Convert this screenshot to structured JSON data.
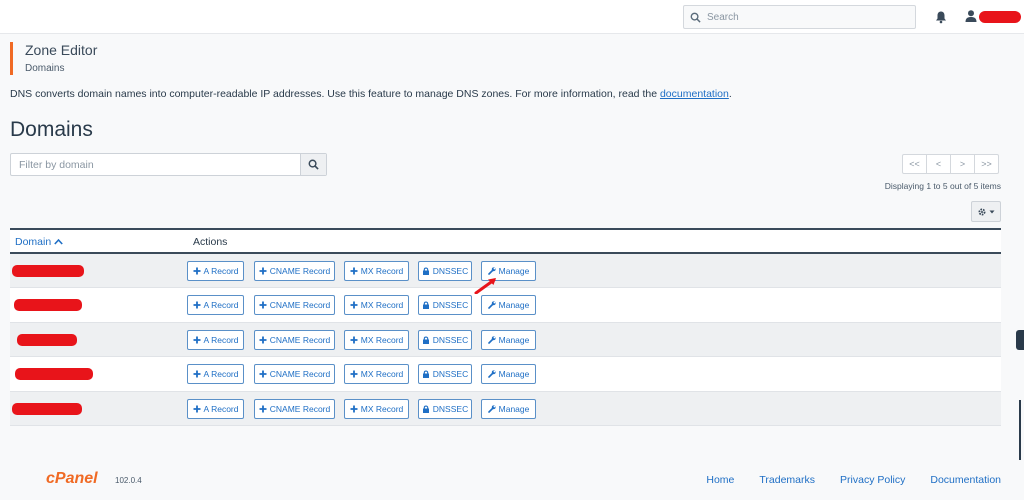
{
  "topbar": {
    "search_placeholder": "Search",
    "icons": [
      "search-icon",
      "bell-icon",
      "user-icon"
    ]
  },
  "breadcrumb": {
    "title": "Zone Editor",
    "subtitle": "Domains"
  },
  "description": {
    "text": "DNS converts domain names into computer-readable IP addresses. Use this feature to manage DNS zones. For more information, read the ",
    "link": "documentation",
    "end": "."
  },
  "heading": "Domains",
  "filter": {
    "placeholder": "Filter by domain"
  },
  "pager": {
    "first": "<<",
    "prev": "<",
    "next": ">",
    "last": ">>",
    "displaying": "Displaying 1 to 5 out of 5 items"
  },
  "table": {
    "headers": {
      "domain": "Domain",
      "actions": "Actions"
    },
    "action_labels": {
      "a_record": "A Record",
      "cname_record": "CNAME Record",
      "mx_record": "MX Record",
      "dnssec": "DNSSEC",
      "manage": "Manage"
    },
    "row_count": 5
  },
  "footer": {
    "logo": "cPanel",
    "version": "102.0.4",
    "links": [
      "Home",
      "Trademarks",
      "Privacy Policy",
      "Documentation"
    ]
  },
  "colors": {
    "accent": "#f06a24",
    "link": "#1f6fc5",
    "redaction": "#e8141a"
  }
}
